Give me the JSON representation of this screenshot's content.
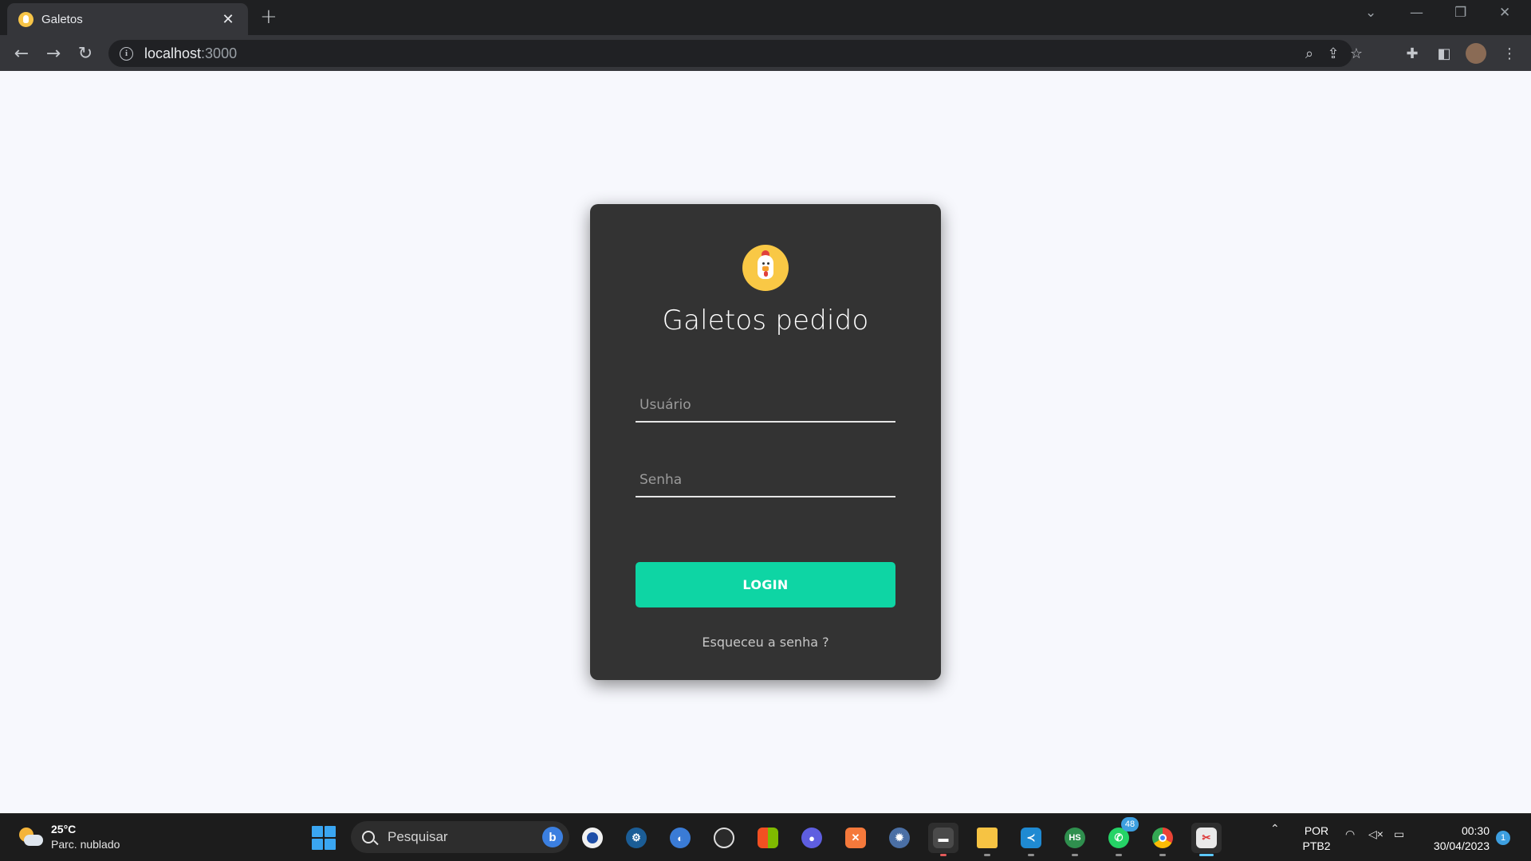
{
  "browser": {
    "tab_title": "Galetos",
    "tab_close": "✕",
    "new_tab": "+",
    "url_host": "localhost",
    "url_port": ":3000",
    "info_glyph": "i"
  },
  "login": {
    "title": "Galetos pedido",
    "username_placeholder": "Usuário",
    "password_placeholder": "Senha",
    "login_button": "LOGIN",
    "forgot_link": "Esqueceu a senha ?",
    "accent_color": "#0ed5a4",
    "card_color": "#333333"
  },
  "taskbar": {
    "weather_temp": "25°C",
    "weather_condition": "Parc. nublado",
    "search_placeholder": "Pesquisar",
    "bing_glyph": "b",
    "hs_label": "HS",
    "whatsapp_badge": "48",
    "language_line1": "POR",
    "language_line2": "PTB2",
    "time": "00:30",
    "date": "30/04/2023",
    "notification_count": "1"
  }
}
